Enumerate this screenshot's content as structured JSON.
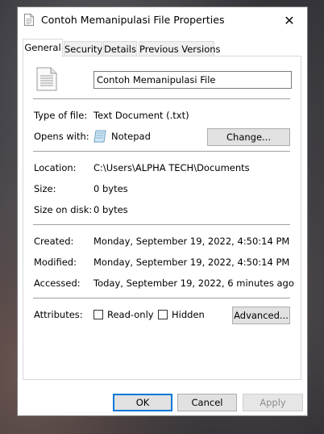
{
  "window": {
    "title": "Contoh Memanipulasi File Properties",
    "close_glyph": "✕"
  },
  "tabs": [
    {
      "label": "General",
      "active": true
    },
    {
      "label": "Security",
      "active": false
    },
    {
      "label": "Details",
      "active": false
    },
    {
      "label": "Previous Versions",
      "active": false
    }
  ],
  "general": {
    "file_name": "Contoh Memanipulasi File",
    "type_label": "Type of file:",
    "type_value": "Text Document (.txt)",
    "opens_label": "Opens with:",
    "opens_value": "Notepad",
    "change_button": "Change...",
    "location_label": "Location:",
    "location_value": "C:\\Users\\ALPHA TECH\\Documents",
    "size_label": "Size:",
    "size_value": "0 bytes",
    "size_on_disk_label": "Size on disk:",
    "size_on_disk_value": "0 bytes",
    "created_label": "Created:",
    "created_value": "Monday, September 19, 2022, 4:50:14 PM",
    "modified_label": "Modified:",
    "modified_value": "Monday, September 19, 2022, 4:50:14 PM",
    "accessed_label": "Accessed:",
    "accessed_value": "Today, September 19, 2022, 6 minutes ago",
    "attributes_label": "Attributes:",
    "readonly_label": "Read-only",
    "readonly_checked": false,
    "hidden_label": "Hidden",
    "hidden_checked": false,
    "advanced_button": "Advanced..."
  },
  "footer": {
    "ok": "OK",
    "cancel": "Cancel",
    "apply": "Apply"
  },
  "icons": {
    "title": "text-file-icon",
    "file": "text-document-icon",
    "app": "notepad-icon",
    "close": "close-icon"
  },
  "colors": {
    "accent": "#0078d7",
    "window_bg": "#ffffff",
    "button_bg": "#e1e1e1"
  }
}
